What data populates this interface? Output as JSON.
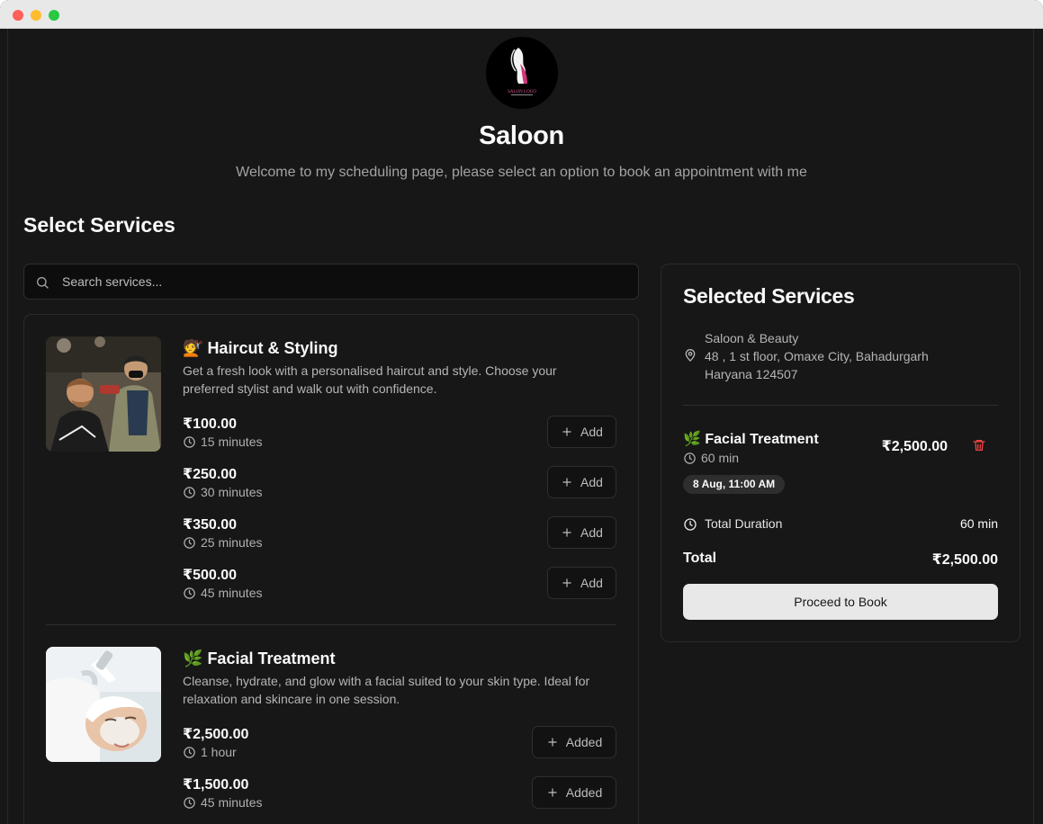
{
  "brand": {
    "logo_text": "SALON LOGO",
    "title": "Saloon",
    "welcome": "Welcome to my scheduling page, please select an option to book an appointment with me"
  },
  "section_title": "Select Services",
  "search": {
    "placeholder": "Search services..."
  },
  "services": [
    {
      "emoji": "💇",
      "title": "Haircut & Styling",
      "description": "Get a fresh look with a personalised haircut and style. Choose your preferred stylist and walk out with confidence.",
      "options": [
        {
          "price": "₹100.00",
          "duration": "15 minutes",
          "button": "Add"
        },
        {
          "price": "₹250.00",
          "duration": "30 minutes",
          "button": "Add"
        },
        {
          "price": "₹350.00",
          "duration": "25 minutes",
          "button": "Add"
        },
        {
          "price": "₹500.00",
          "duration": "45 minutes",
          "button": "Add"
        }
      ]
    },
    {
      "emoji": "🌿",
      "title": "Facial Treatment",
      "description": "Cleanse, hydrate, and glow with a facial suited to your skin type. Ideal for relaxation and skincare in one session.",
      "options": [
        {
          "price": "₹2,500.00",
          "duration": "1 hour",
          "button": "Added"
        },
        {
          "price": "₹1,500.00",
          "duration": "45 minutes",
          "button": "Added"
        }
      ]
    }
  ],
  "summary": {
    "title": "Selected Services",
    "location": {
      "line1": "Saloon & Beauty",
      "line2": "48 , 1 st floor, Omaxe City, Bahadurgarh",
      "line3": "Haryana 124507"
    },
    "selected_item": {
      "emoji": "🌿",
      "name": "Facial Treatment",
      "duration": "60 min",
      "price": "₹2,500.00",
      "slot": "8 Aug, 11:00 AM"
    },
    "total_duration_label": "Total Duration",
    "total_duration_value": "60 min",
    "total_label": "Total",
    "total_value": "₹2,500.00",
    "proceed_label": "Proceed to Book"
  },
  "colors": {
    "background": "#171717",
    "text": "#fafafa",
    "muted": "#a3a3a3",
    "border": "#2a2a2a",
    "danger": "#ef4444",
    "primary_button": "#e8e8e8"
  },
  "icons": [
    "search-icon",
    "clock-icon",
    "plus-icon",
    "map-pin-icon",
    "trash-icon"
  ]
}
